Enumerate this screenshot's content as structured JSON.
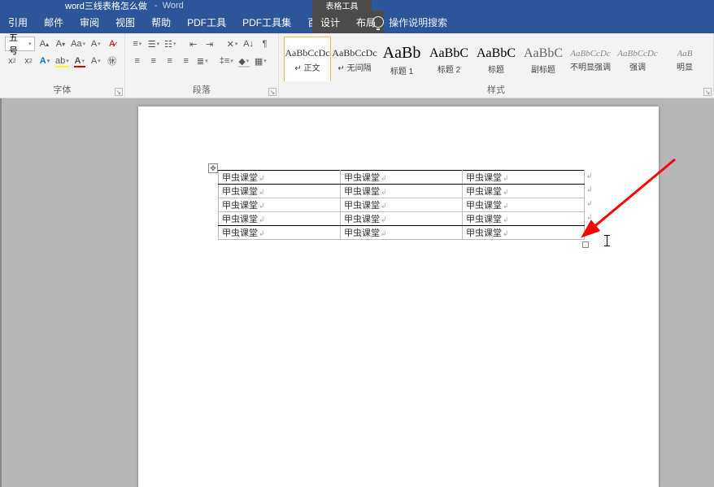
{
  "title": {
    "doc": "word三线表格怎么做",
    "sep": "-",
    "app": "Word"
  },
  "contextual_tab_title": "表格工具",
  "tabs": {
    "items": [
      "引用",
      "邮件",
      "审阅",
      "视图",
      "帮助",
      "PDF工具",
      "PDF工具集",
      "百度网盘"
    ],
    "context": [
      "设计",
      "布局"
    ],
    "tellme": "操作说明搜索"
  },
  "ribbon": {
    "font_size": "五号",
    "font_group": "字体",
    "para_group": "段落",
    "styles_group": "样式",
    "styles": [
      {
        "preview": "AaBbCcDc",
        "name": "正文",
        "size": 12,
        "color": "#333",
        "prefix": "↵ "
      },
      {
        "preview": "AaBbCcDc",
        "name": "无间隔",
        "size": 12,
        "color": "#333",
        "prefix": "↵ "
      },
      {
        "preview": "AaBb",
        "name": "标题 1",
        "size": 20,
        "color": "#000",
        "prefix": ""
      },
      {
        "preview": "AaBbC",
        "name": "标题 2",
        "size": 16,
        "color": "#000",
        "prefix": ""
      },
      {
        "preview": "AaBbC",
        "name": "标题",
        "size": 16,
        "color": "#000",
        "prefix": ""
      },
      {
        "preview": "AaBbC",
        "name": "副标题",
        "size": 16,
        "color": "#666",
        "prefix": ""
      },
      {
        "preview": "AaBbCcDc",
        "name": "不明显强调",
        "size": 11,
        "color": "#888",
        "prefix": "",
        "italic": true
      },
      {
        "preview": "AaBbCcDc",
        "name": "强调",
        "size": 11,
        "color": "#888",
        "prefix": "",
        "italic": true
      },
      {
        "preview": "AaB",
        "name": "明显",
        "size": 11,
        "color": "#888",
        "prefix": "",
        "italic": true
      }
    ]
  },
  "table": {
    "cell": "甲虫课堂",
    "rows": 5,
    "cols": 3
  }
}
